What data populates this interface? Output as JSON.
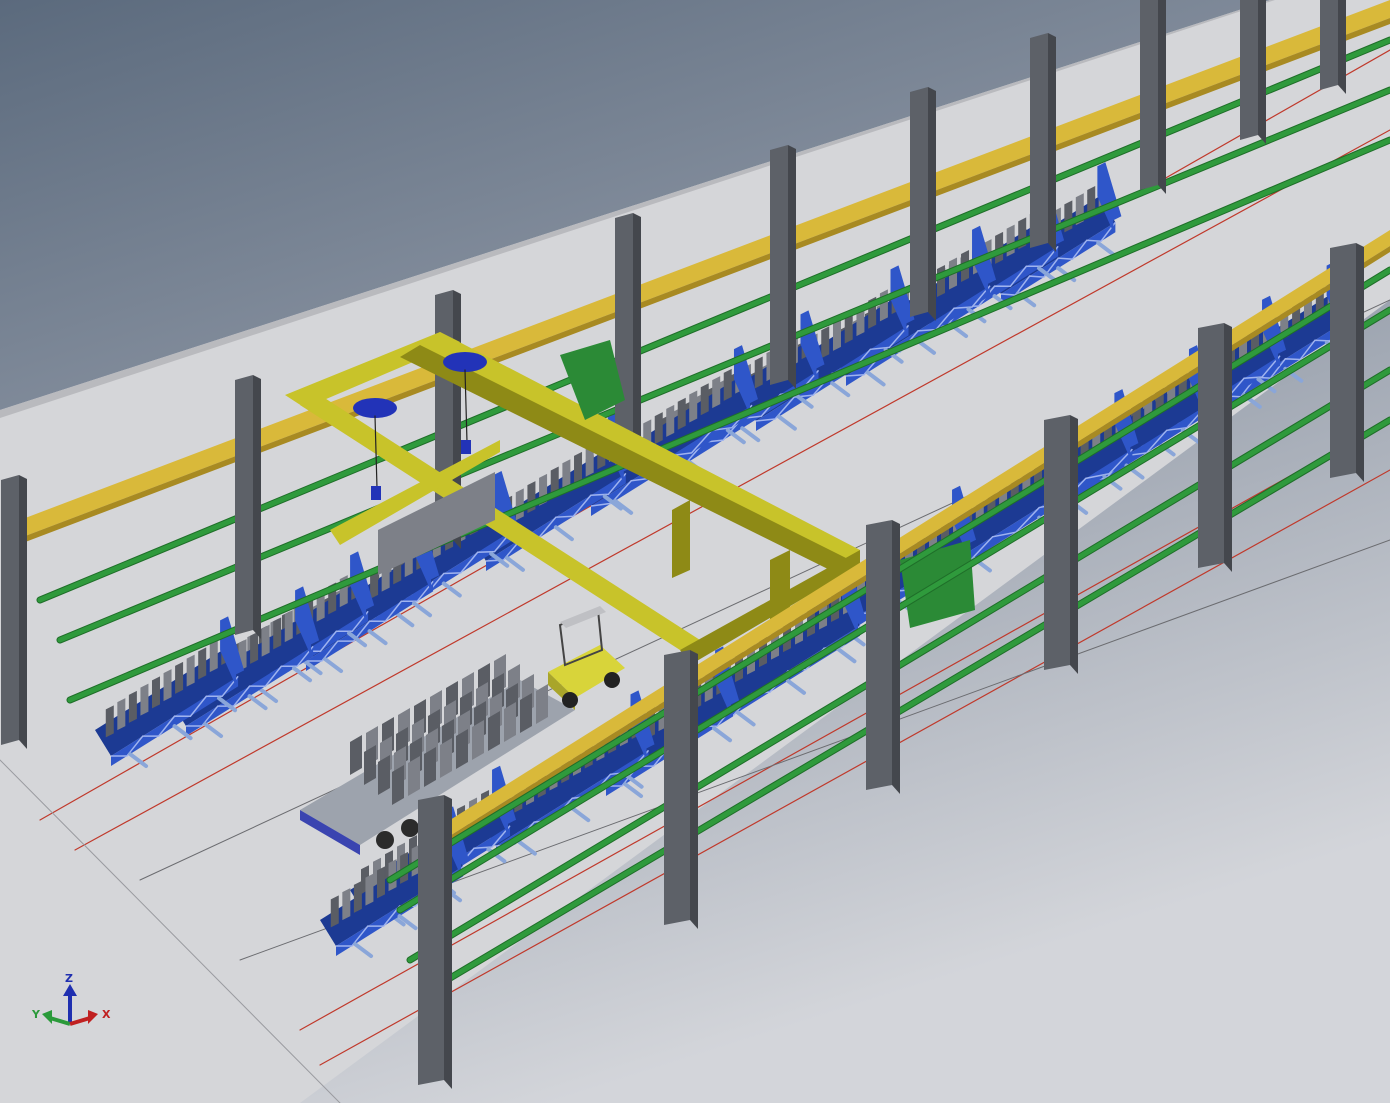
{
  "scene": {
    "description_free": true,
    "colors": {
      "background_top": "#5f6e80",
      "background_bottom": "#c9ccd3",
      "floor": "#d6d7da",
      "floor_edge": "#bfc0c4",
      "column": "#5d6168",
      "column_side": "#44474d",
      "runway_beam": "#d9b93a",
      "runway_beam_dark": "#a88a22",
      "rail_green": "#2f9a3c",
      "rail_green_dark": "#1f6e29",
      "gantry": "#c8c32a",
      "gantry_dark": "#8e8a16",
      "hoist": "#2233b8",
      "mold_frame": "#2f56c9",
      "mold_frame_dark": "#1c3a93",
      "panel": "#7d8088",
      "panel_dark": "#5a5d64",
      "forklift": "#d8d43a",
      "trailer": "#9da3ad",
      "red_line": "#c0392b"
    },
    "icons": [
      "axis-triad-icon",
      "hoist-icon"
    ],
    "floor_markers": [
      "",
      "",
      "",
      ""
    ]
  },
  "triad": {
    "z_label": "Z",
    "y_label": "Y",
    "x_label": "X"
  }
}
